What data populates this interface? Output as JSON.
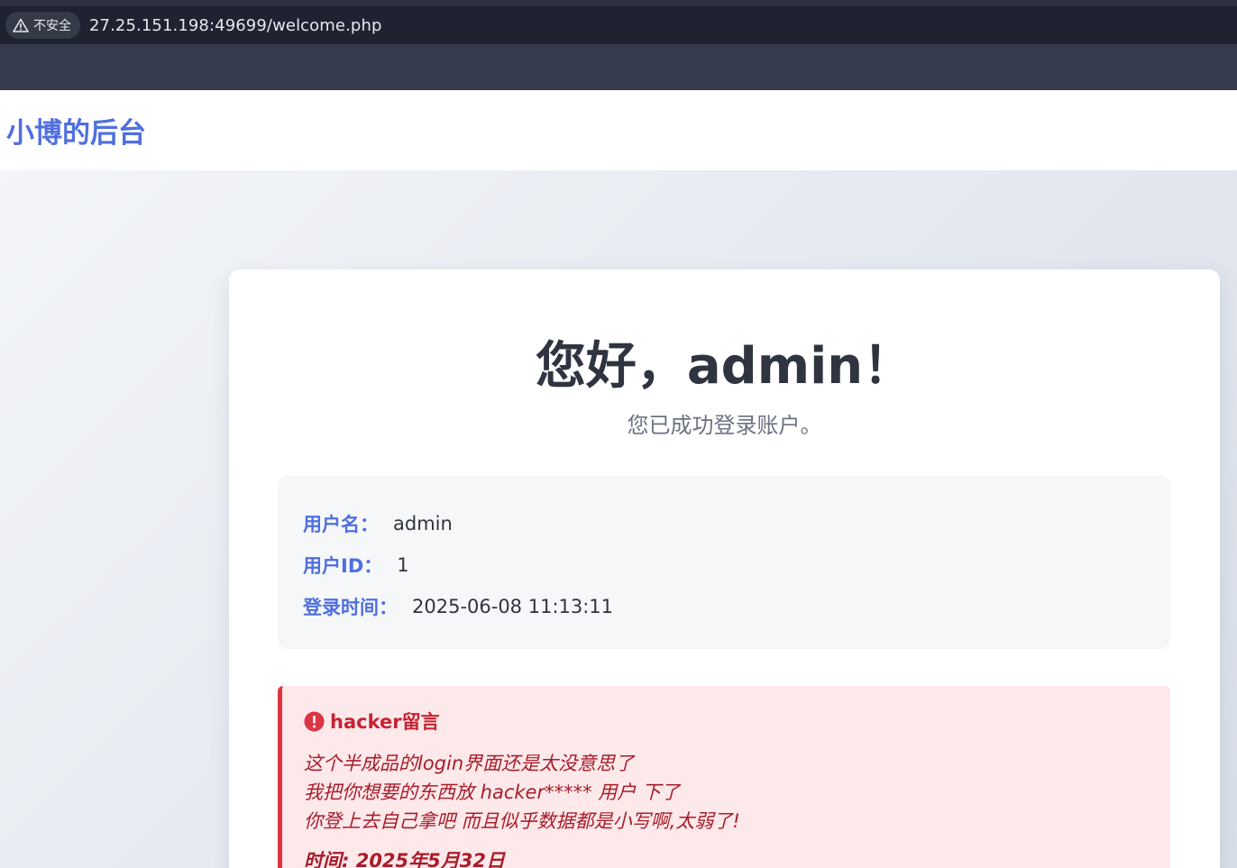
{
  "browser": {
    "security_label": "不安全",
    "url": "27.25.151.198:49699/welcome.php"
  },
  "header": {
    "brand": "小博的后台"
  },
  "welcome": {
    "greeting": "您好，admin！",
    "subtitle": "您已成功登录账户。"
  },
  "user_info": [
    {
      "label": "用户名：",
      "value": "admin"
    },
    {
      "label": "用户ID：",
      "value": "1"
    },
    {
      "label": "登录时间：",
      "value": "2025-06-08 11:13:11"
    }
  ],
  "alert": {
    "title": "hacker留言",
    "lines": [
      "这个半成品的login界面还是太没意思了",
      "我把你想要的东西放 hacker***** 用户 下了",
      "你登上去自己拿吧 而且似乎数据都是小写啊,太弱了!"
    ],
    "time": "时间: 2025年5月32日"
  },
  "colors": {
    "brand": "#4f6fe0",
    "alert_border": "#dc3545",
    "alert_bg": "#fde8ea"
  },
  "icons": {
    "security": "warning-triangle-icon",
    "alert": "exclamation-circle-icon"
  }
}
